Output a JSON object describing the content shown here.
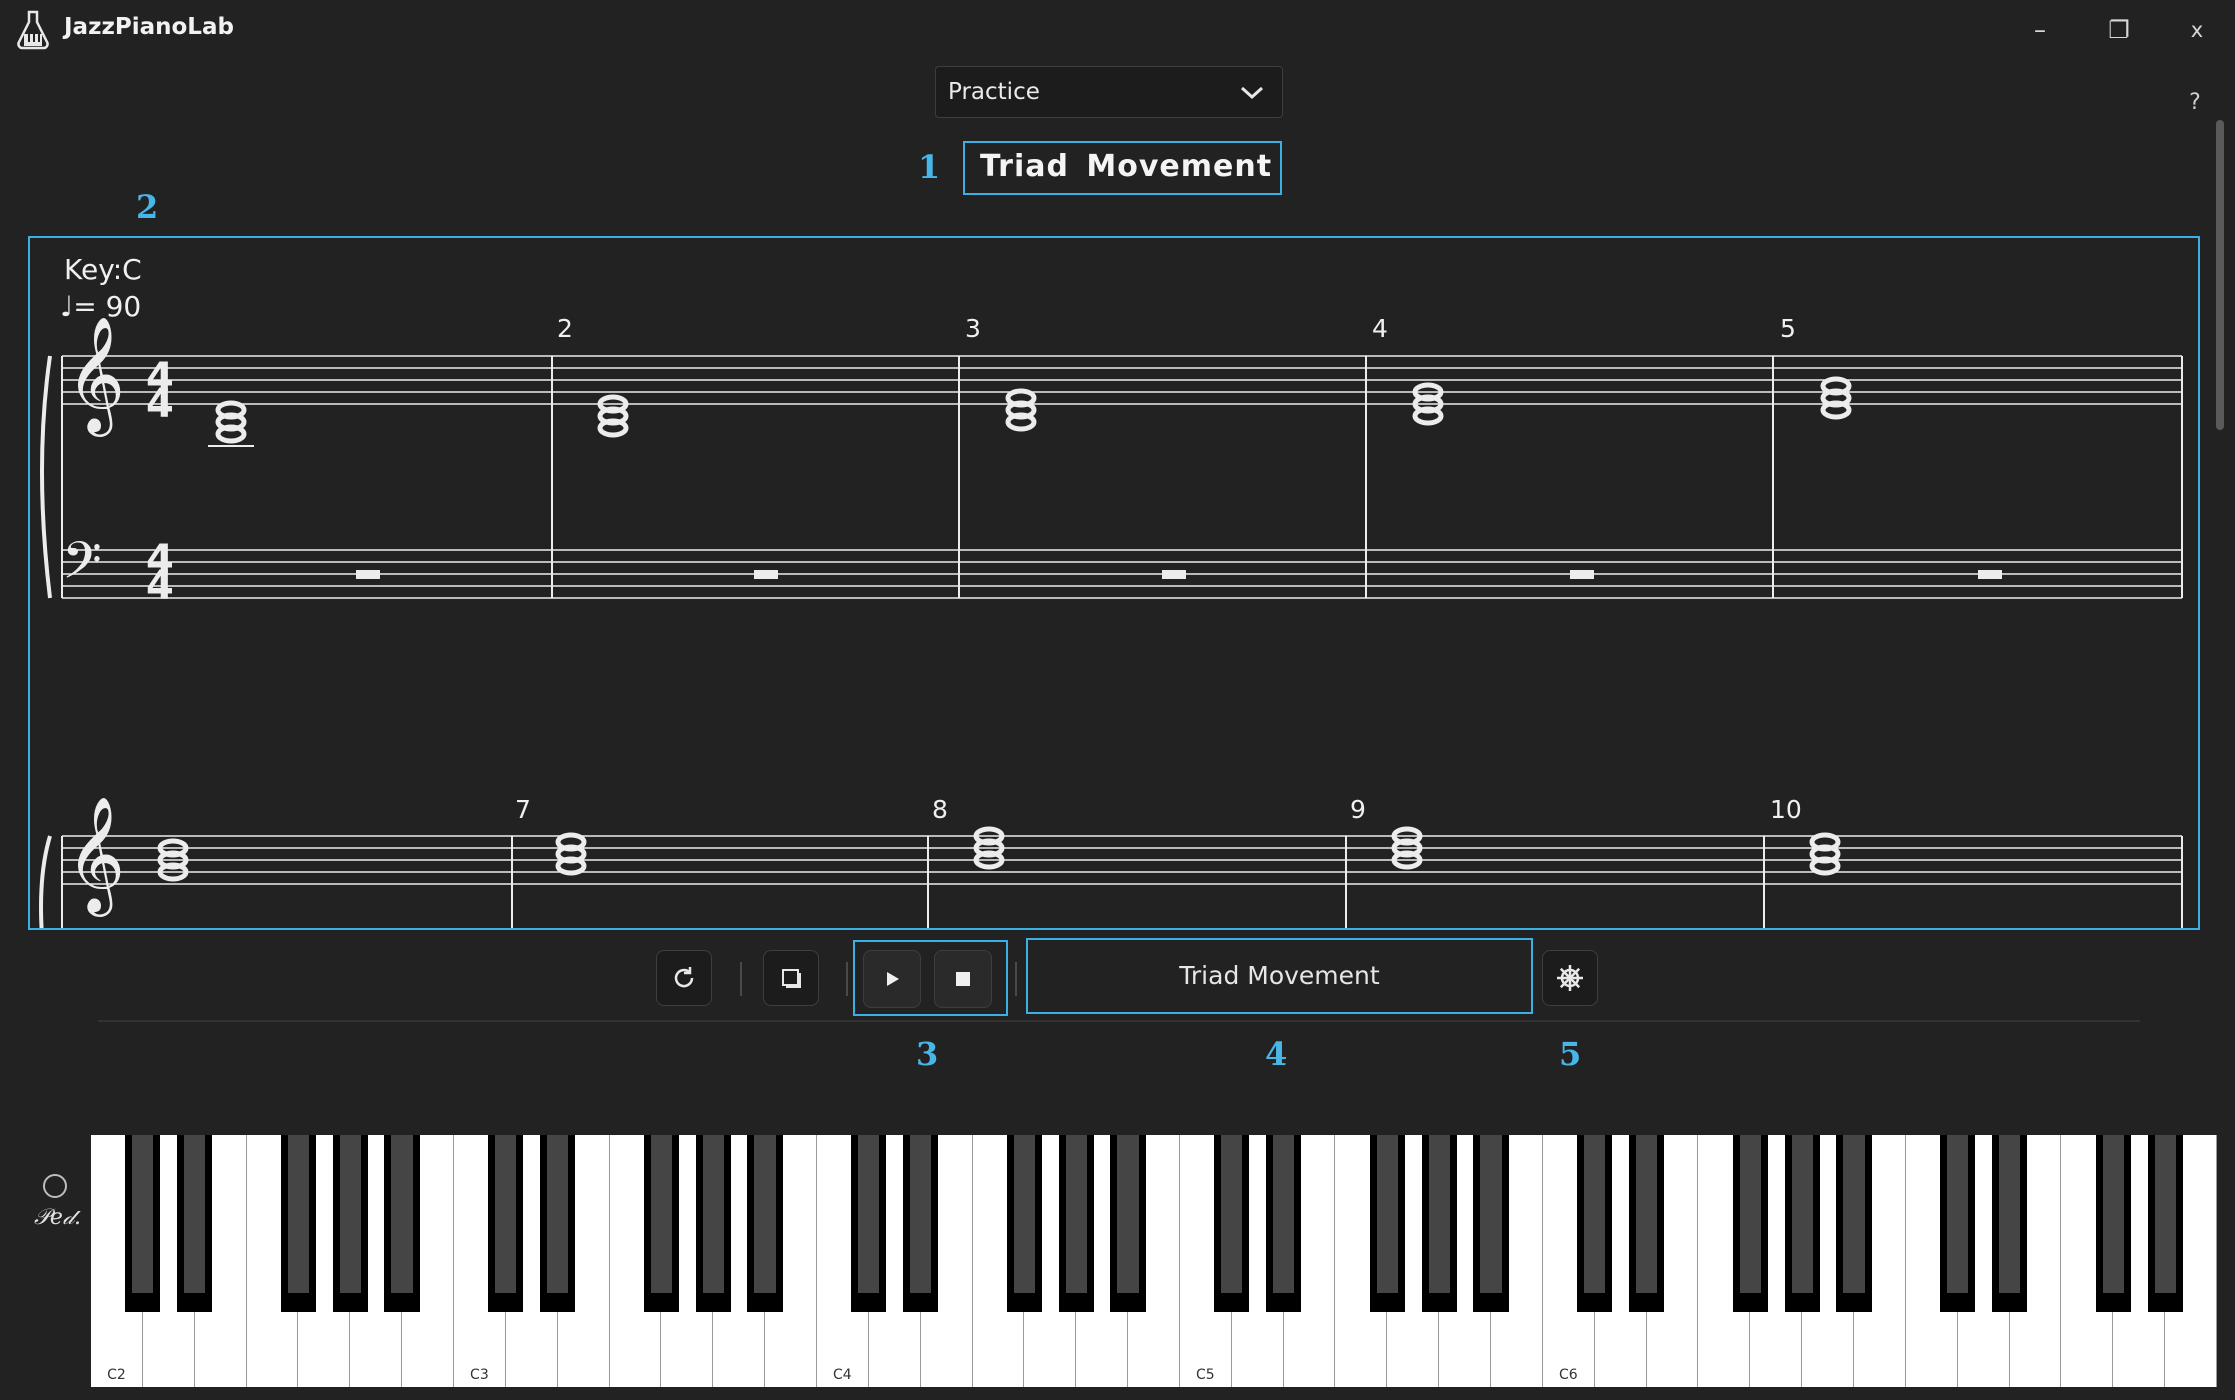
{
  "app": {
    "title": "JazzPianoLab",
    "window_controls": {
      "minimize": "–",
      "maximize": "❐",
      "close": "x"
    },
    "help": "?"
  },
  "mode_select": {
    "value": "Practice"
  },
  "callouts": {
    "title_box": "1",
    "score": "2",
    "transport": "3",
    "exercise": "4",
    "settings": "5"
  },
  "exercise_title": "Triad  Movement",
  "score": {
    "key": "Key:C",
    "tempo": "♩= 90",
    "time_signature": "4/4",
    "system1_measure_numbers": [
      "2",
      "3",
      "4",
      "5"
    ],
    "system2_measure_numbers": [
      "7",
      "8",
      "9",
      "10"
    ]
  },
  "toolbar": {
    "loop_icon": "loop-icon",
    "view_icon": "window-icon",
    "play_icon": "play-icon",
    "stop_icon": "stop-icon",
    "exercise_name": "Triad Movement",
    "settings_icon": "helm-icon"
  },
  "pedal": {
    "label": "𝒫𝑒𝒹."
  },
  "keyboard": {
    "white_key_count": 41,
    "c_labels": [
      "C2",
      "C3",
      "C4",
      "C5",
      "C6"
    ]
  }
}
